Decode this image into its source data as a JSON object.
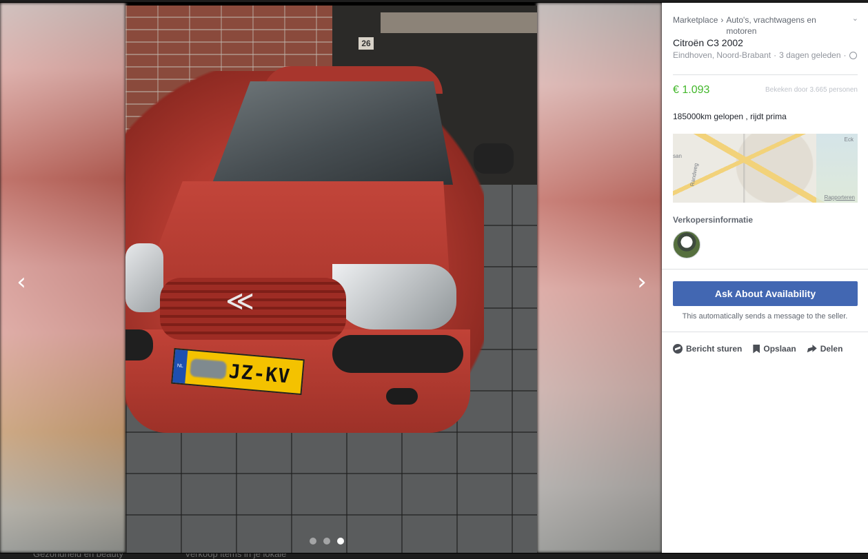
{
  "backdrop": {
    "left_text": "Gezondheid en beauty",
    "right_text": "Verkoop items in je lokale"
  },
  "viewer": {
    "prev_icon": "chevron-left-icon",
    "next_icon": "chevron-right-icon",
    "plate_text": "JZ-KV",
    "plate_country": "NL",
    "house_number": "26",
    "photo_count": 3,
    "active_photo_index": 3
  },
  "panel": {
    "breadcrumb": {
      "root": "Marketplace",
      "separator": "›",
      "category": "Auto's, vrachtwagens en motoren"
    },
    "title": "Citroën C3 2002",
    "location": "Eindhoven, Noord-Brabant",
    "dot": "·",
    "posted": "3 dagen geleden",
    "price": "€ 1.093",
    "views": "Bekeken door 3.665 personen",
    "description": "185000km gelopen , rijdt prima",
    "map": {
      "label_1": "san",
      "label_2": "Randweg",
      "label_3": "Eck",
      "report": "Rapporteren"
    },
    "seller_section_title": "Verkopersinformatie",
    "cta_label": "Ask About Availability",
    "cta_note": "This automatically sends a message to the seller.",
    "actions": {
      "message": "Bericht sturen",
      "save": "Opslaan",
      "share": "Delen"
    }
  },
  "colors": {
    "accent": "#4267b2",
    "price": "#42b72a"
  }
}
